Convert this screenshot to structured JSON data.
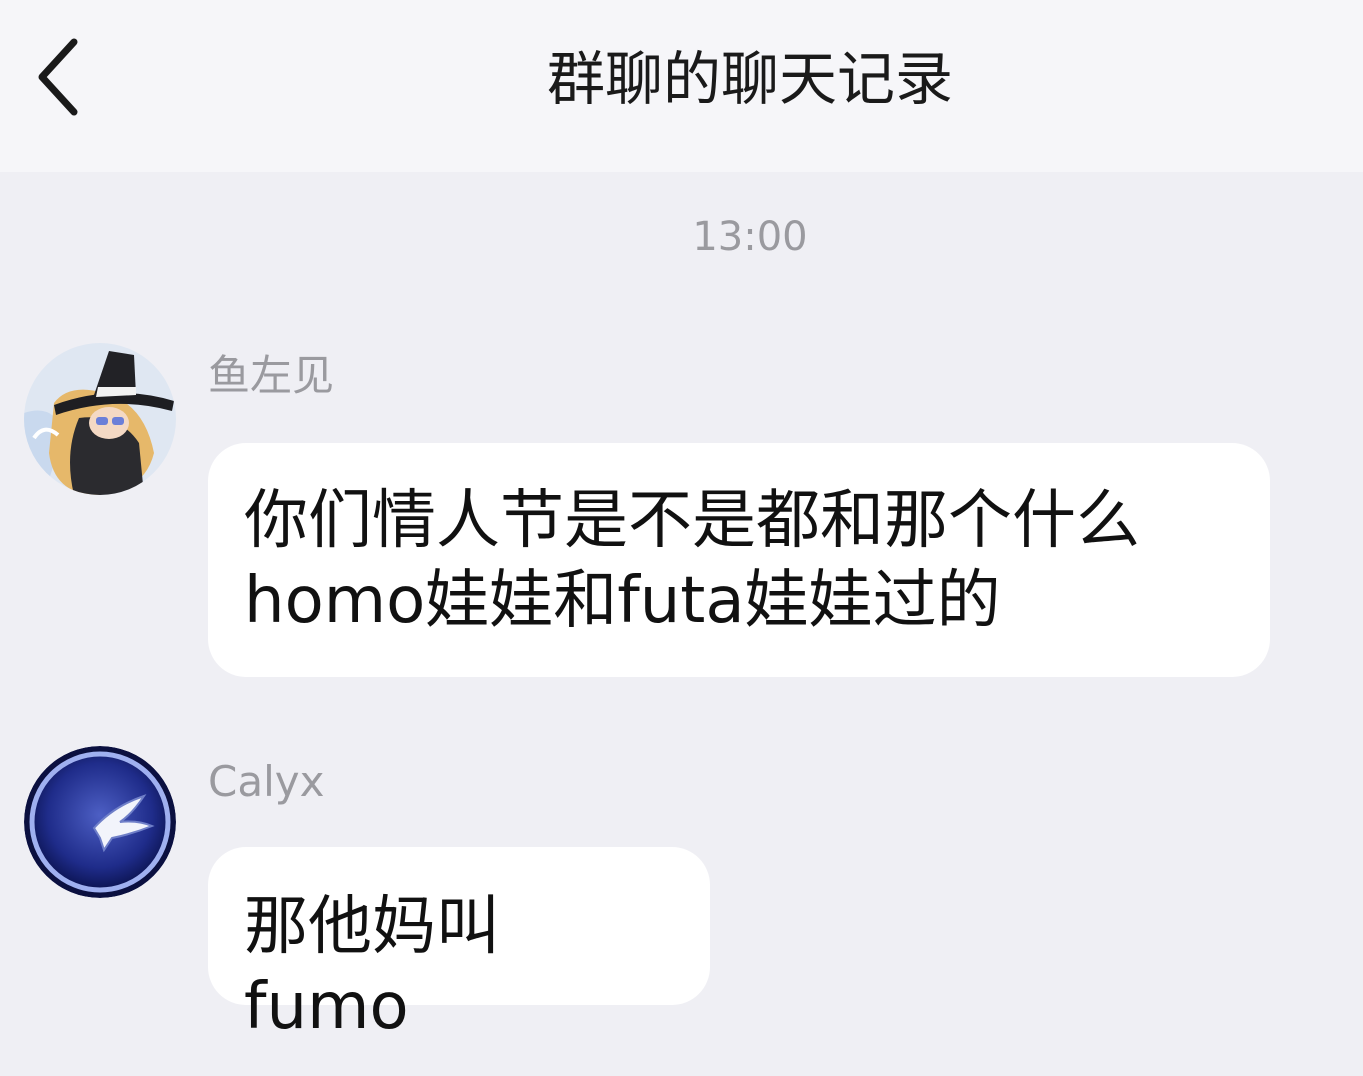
{
  "header": {
    "back_icon": "chevron-left-icon",
    "title": "群聊的聊天记录"
  },
  "timestamp": "13:00",
  "messages": [
    {
      "sender": "鱼左见",
      "avatar": "witch-character-avatar",
      "lines": [
        "你们情人节是不是都和那个什么",
        "homo娃娃和futa娃娃过的"
      ]
    },
    {
      "sender": "Calyx",
      "avatar": "falcon-crescent-emblem-avatar",
      "lines": [
        "那他妈叫 fumo"
      ]
    }
  ],
  "colors": {
    "background": "#efeff4",
    "header_background": "#f6f6f9",
    "bubble": "#ffffff",
    "meta_text": "#9a9a9f"
  }
}
